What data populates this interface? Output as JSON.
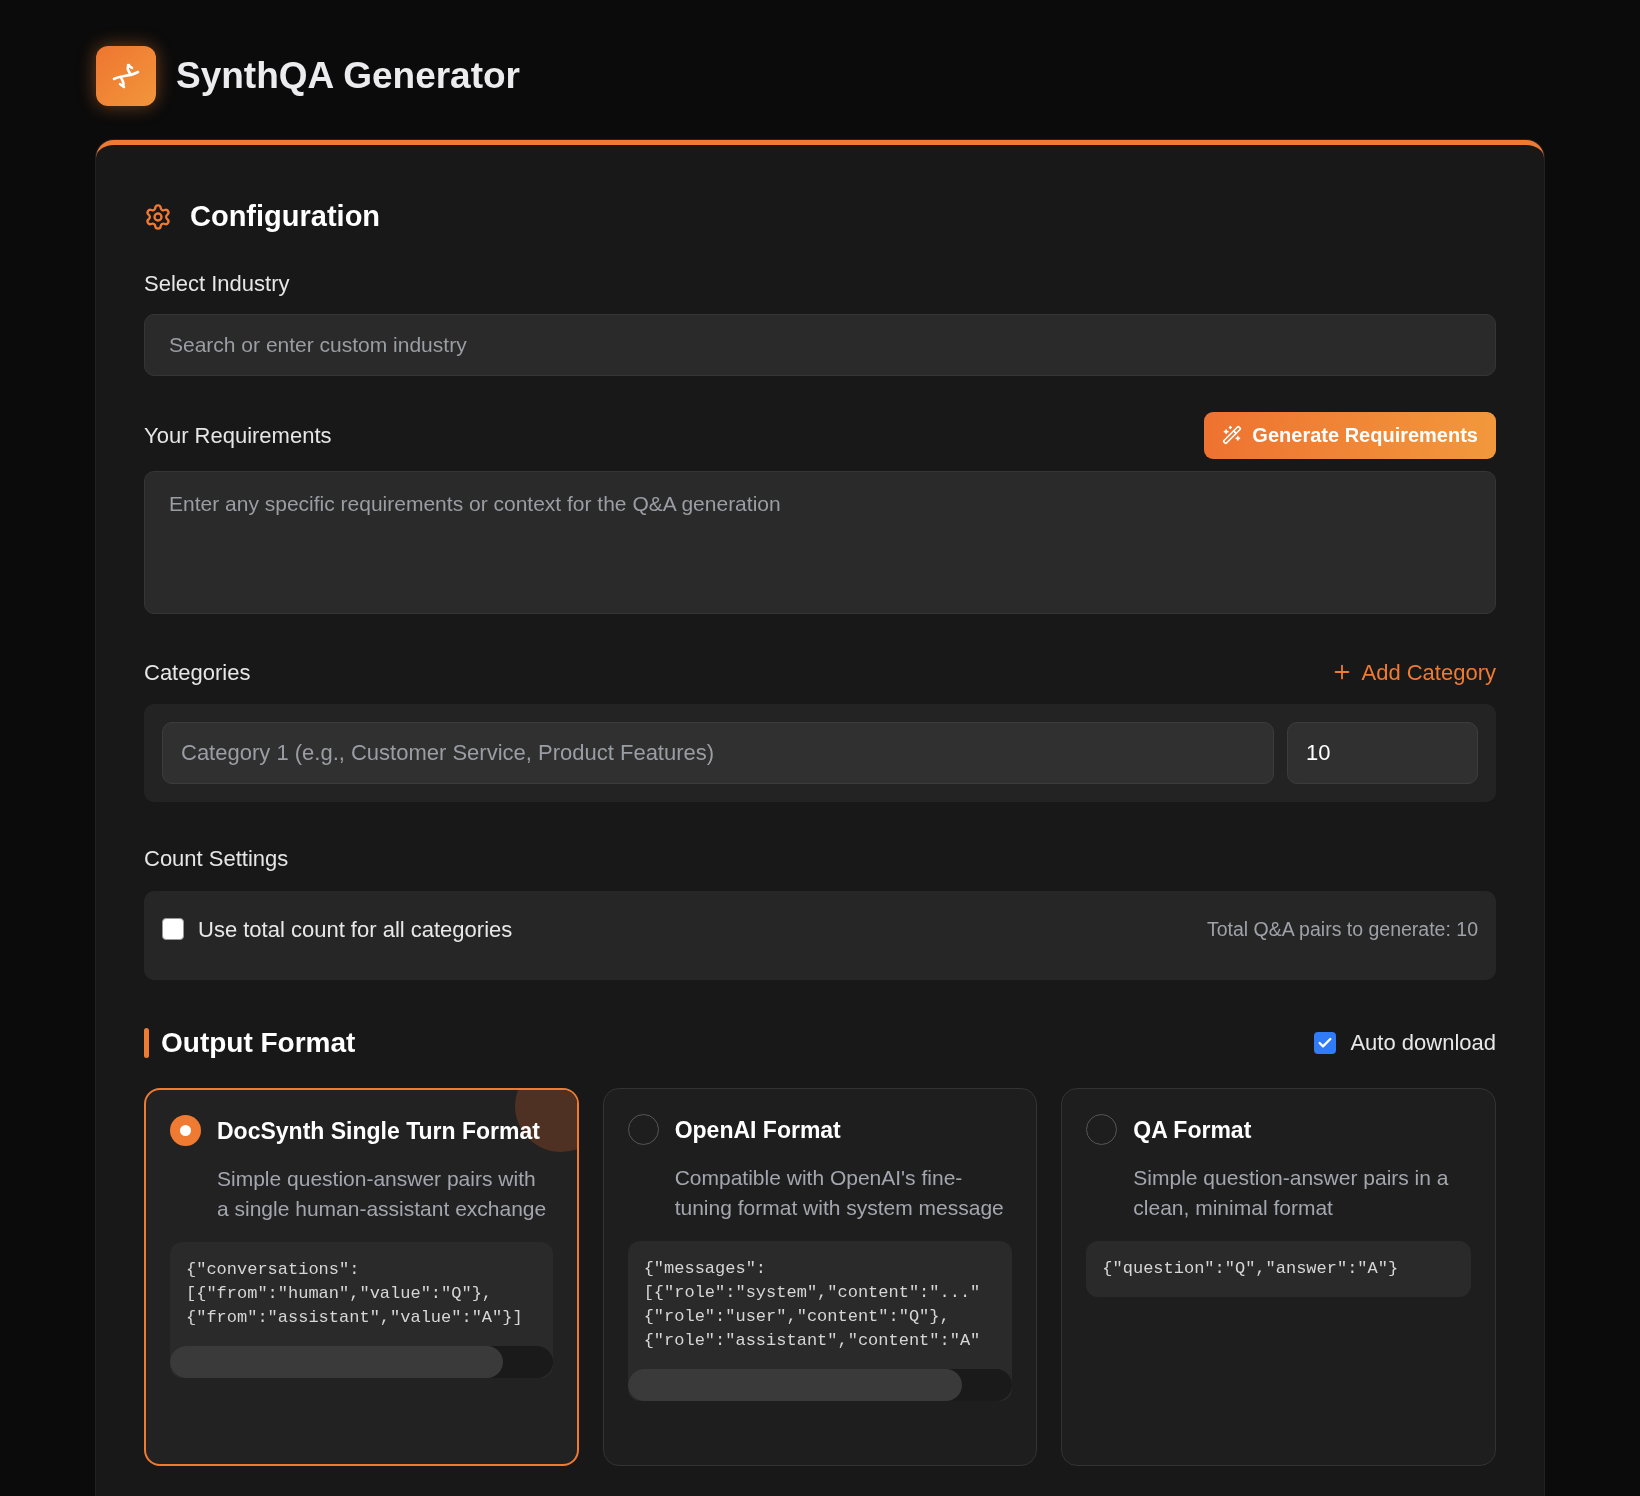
{
  "app": {
    "title": "SynthQA Generator"
  },
  "configuration": {
    "heading": "Configuration",
    "industry": {
      "label": "Select Industry",
      "placeholder": "Search or enter custom industry"
    },
    "requirements": {
      "label": "Your Requirements",
      "button": "Generate Requirements",
      "placeholder": "Enter any specific requirements or context for the Q&A generation"
    },
    "categories": {
      "label": "Categories",
      "add_button": "Add Category",
      "items": [
        {
          "placeholder": "Category 1 (e.g., Customer Service, Product Features)",
          "count": "10"
        }
      ]
    },
    "count_settings": {
      "label": "Count Settings",
      "use_total": {
        "label": "Use total count for all categories",
        "checked": false
      },
      "total_text": "Total Q&A pairs to generate: 10"
    },
    "output_format": {
      "heading": "Output Format",
      "auto_download": {
        "label": "Auto download",
        "checked": true
      },
      "formats": [
        {
          "name": "DocSynth Single Turn Format",
          "description": "Simple question-answer pairs with a single human-assistant exchange",
          "selected": true,
          "code": [
            "{\"conversations\":",
            "[{\"from\":\"human\",\"value\":\"Q\"},",
            "{\"from\":\"assistant\",\"value\":\"A\"}]"
          ],
          "scrollable": true
        },
        {
          "name": "OpenAI Format",
          "description": "Compatible with OpenAI's fine-tuning format with system message",
          "selected": false,
          "code": [
            "{\"messages\":",
            "[{\"role\":\"system\",\"content\":\"...\"",
            "{\"role\":\"user\",\"content\":\"Q\"},",
            "{\"role\":\"assistant\",\"content\":\"A\""
          ],
          "scrollable": true
        },
        {
          "name": "QA Format",
          "description": "Simple question-answer pairs in a clean, minimal format",
          "selected": false,
          "code": [
            "{\"question\":\"Q\",\"answer\":\"A\"}"
          ],
          "scrollable": false
        }
      ]
    }
  }
}
